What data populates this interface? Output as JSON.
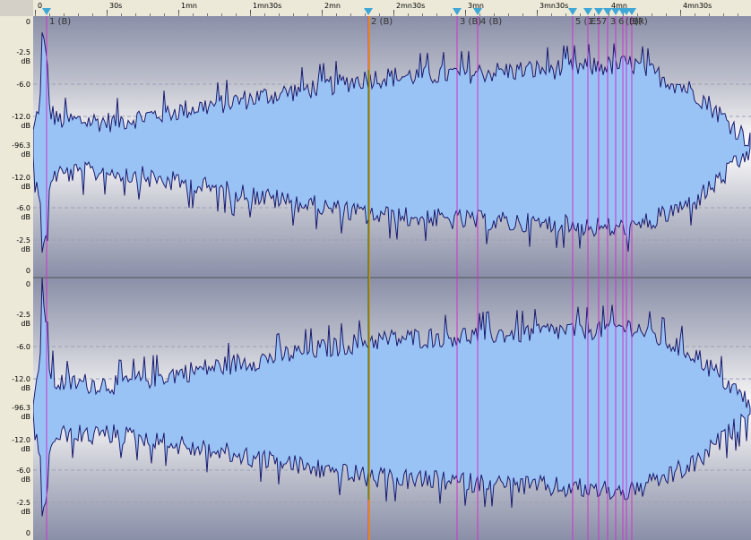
{
  "ruler": {
    "ticks": [
      "0",
      "30s",
      "1mn",
      "1mn30s",
      "2mn",
      "2mn30s",
      "3mn",
      "3mn30s",
      "4mn",
      "4mn30s"
    ]
  },
  "channels": [
    {
      "name": "top",
      "db_labels": [
        "0",
        "-2.5",
        "dB",
        "-6.0",
        "-12.0",
        "dB",
        "-96.3",
        "dB",
        "-12.0",
        "dB",
        "-6.0",
        "dB",
        "-2.5",
        "dB",
        "0"
      ]
    },
    {
      "name": "bottom",
      "db_labels": [
        "0",
        "-2.5",
        "dB",
        "-6.0",
        "-12.0",
        "dB",
        "-96.3",
        "dB",
        "-12.0",
        "dB",
        "-6.0",
        "dB",
        "-2.5",
        "dB",
        "0"
      ]
    }
  ],
  "markers": [
    {
      "label": "1 (B)"
    },
    {
      "label": "2 (B)"
    },
    {
      "label": "3 (B)"
    },
    {
      "label": "4 (B)"
    },
    {
      "label": "5 (1.5"
    },
    {
      "label": "E"
    },
    {
      "label": "7"
    },
    {
      "label": "3"
    },
    {
      "label": "6"
    },
    {
      "label": "(B)"
    },
    {
      "label": "(B)"
    },
    {
      "label": "(R)"
    }
  ],
  "colors": {
    "wave_fill": "#9ac3f5",
    "wave_outline": "#1a1a6e",
    "marker_line": "#cc33cc",
    "cursor_line": "#e08a1a",
    "marker_triangle": "#3fa7d6"
  }
}
